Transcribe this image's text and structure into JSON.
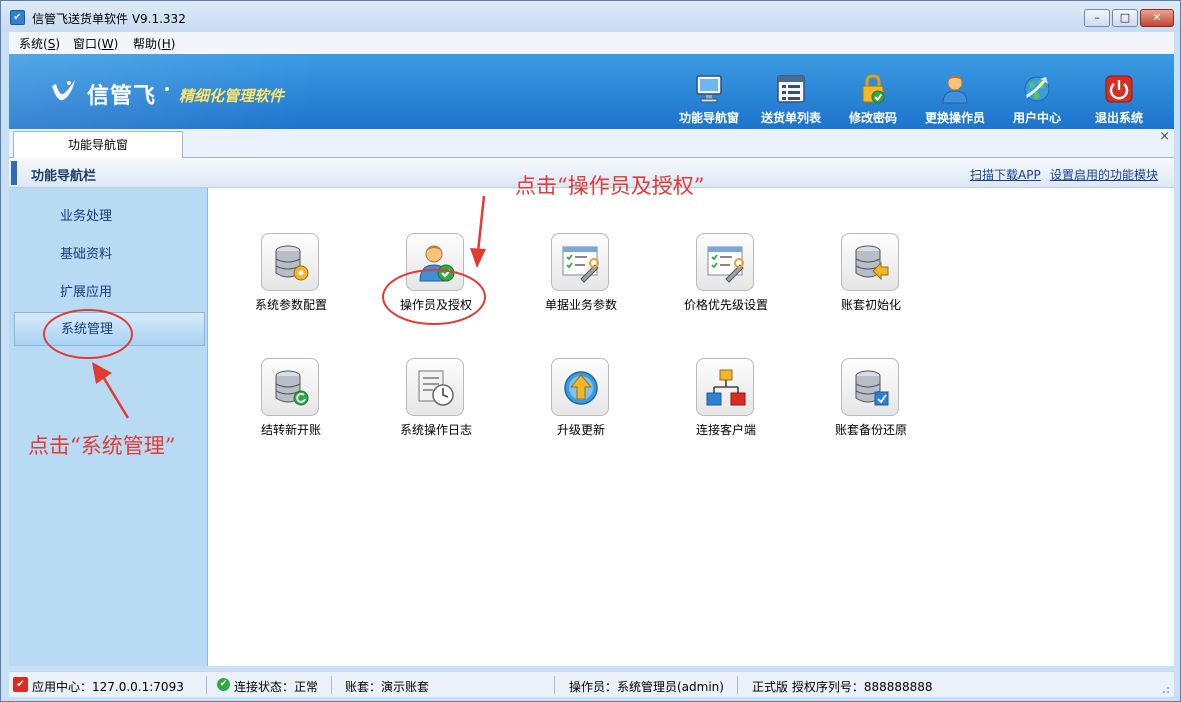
{
  "window": {
    "title": "信管飞送货单软件 V9.1.332",
    "app_icon": "app-logo-icon",
    "controls": {
      "minimize": "–",
      "maximize": "□",
      "close": "✕"
    }
  },
  "menu": [
    {
      "label": "系统(",
      "key": "S",
      "after": ")"
    },
    {
      "label": "窗口(",
      "key": "W",
      "after": ")"
    },
    {
      "label": "帮助(",
      "key": "H",
      "after": ")"
    }
  ],
  "header": {
    "logo_name": "信管飞",
    "slogan": "精细化管理软件",
    "toolbar": [
      {
        "label": "功能导航窗",
        "icon": "monitor-icon"
      },
      {
        "label": "送货单列表",
        "icon": "list-icon"
      },
      {
        "label": "修改密码",
        "icon": "lock-icon"
      },
      {
        "label": "更换操作员",
        "icon": "user-icon"
      },
      {
        "label": "用户中心",
        "icon": "globe-icon"
      },
      {
        "label": "退出系统",
        "icon": "power-icon"
      }
    ]
  },
  "tabs": [
    {
      "label": "功能导航窗"
    }
  ],
  "tab_close": "×",
  "nav": {
    "title": "功能导航栏",
    "links": [
      "扫描下载APP",
      "设置启用的功能模块"
    ]
  },
  "sidebar": {
    "items": [
      {
        "label": "业务处理",
        "active": false
      },
      {
        "label": "基础资料",
        "active": false
      },
      {
        "label": "扩展应用",
        "active": false
      },
      {
        "label": "系统管理",
        "active": true
      }
    ]
  },
  "functions": [
    {
      "label": "系统参数配置",
      "icon": "database-gear-icon"
    },
    {
      "label": "操作员及授权",
      "icon": "user-check-icon"
    },
    {
      "label": "单据业务参数",
      "icon": "checklist-tools-icon"
    },
    {
      "label": "价格优先级设置",
      "icon": "checklist-tools-icon"
    },
    {
      "label": "账套初始化",
      "icon": "database-arrow-icon"
    },
    {
      "label": "结转新开账",
      "icon": "database-refresh-icon"
    },
    {
      "label": "系统操作日志",
      "icon": "log-clock-icon"
    },
    {
      "label": "升级更新",
      "icon": "upgrade-arrow-icon"
    },
    {
      "label": "连接客户端",
      "icon": "network-icon"
    },
    {
      "label": "账套备份还原",
      "icon": "database-backup-icon"
    }
  ],
  "annotations": {
    "top": "点击“操作员及授权”",
    "left": "点击“系统管理”"
  },
  "status": {
    "app_center": "应用中心：127.0.0.1:7093",
    "connection": "连接状态：正常",
    "account": "账套：演示账套",
    "operator": "操作员：系统管理员(admin)",
    "license": "正式版 授权序列号：888888888"
  },
  "colors": {
    "header_blue": "#1d74cc",
    "sidebar_blue": "#b9daf3",
    "annotation_red": "#e23a35",
    "slogan_yellow": "#ffe46a"
  }
}
